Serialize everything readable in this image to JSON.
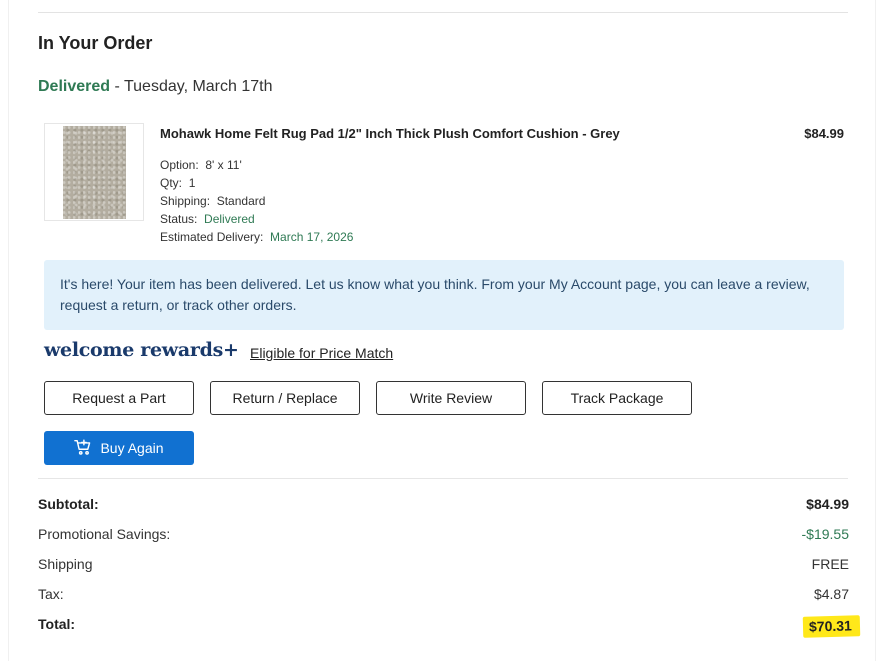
{
  "order": {
    "heading": "In Your Order",
    "delivery_status": "Delivered",
    "delivery_date": " - Tuesday, March 17th"
  },
  "item": {
    "title": "Mohawk Home Felt Rug Pad 1/2\" Inch Thick Plush Comfort Cushion - Grey",
    "price": "$84.99",
    "option_label": "Option:",
    "option_value": "8' x 11'",
    "qty_label": "Qty:",
    "qty_value": "1",
    "shipping_label": "Shipping:",
    "shipping_value": "Standard",
    "status_label": "Status:",
    "status_value": "Delivered",
    "eta_label": "Estimated Delivery:",
    "eta_value": "March 17, 2026"
  },
  "notice": {
    "text": "It's here! Your item has been delivered. Let us know what you think. From your My Account page, you can leave a review, request a return, or track other orders."
  },
  "rewards": {
    "logo_text": "welcome rewards+",
    "price_match_link": "Eligible for Price Match"
  },
  "actions": {
    "request_part": "Request a Part",
    "return_replace": "Return / Replace",
    "write_review": "Write Review",
    "track_package": "Track Package",
    "buy_again": "Buy Again"
  },
  "summary": {
    "subtotal_label": "Subtotal:",
    "subtotal_value": "$84.99",
    "promo_label": "Promotional Savings:",
    "promo_value": "-$19.55",
    "shipping_label": "Shipping",
    "shipping_value": "FREE",
    "tax_label": "Tax:",
    "tax_value": "$4.87",
    "total_label": "Total:",
    "total_value": "$70.31"
  },
  "colors": {
    "delivered_green": "#2f7a54",
    "buy_again_blue": "#1171d1",
    "notice_bg": "#e2f1fb",
    "highlight_yellow": "#ffe81a",
    "rewards_navy": "#1a3a6b"
  }
}
